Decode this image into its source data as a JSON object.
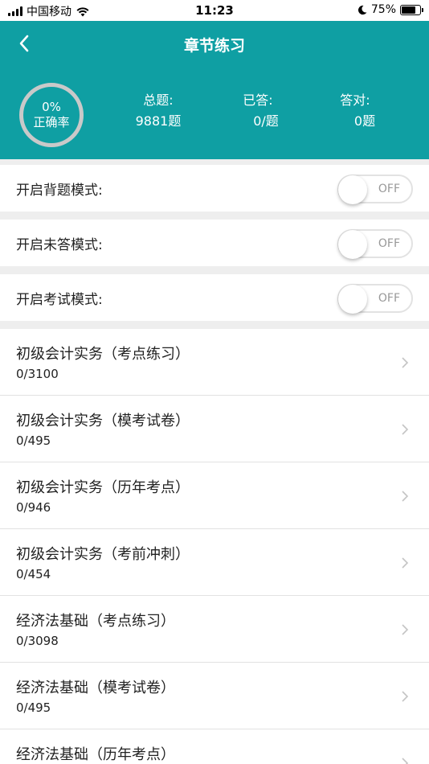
{
  "status_bar": {
    "carrier": "中国移动",
    "time": "11:23",
    "battery_percent": "75%",
    "battery_level": 0.75
  },
  "header": {
    "title": "章节练习",
    "back_icon": "chevron-left-icon",
    "accuracy": {
      "value": "0%",
      "label": "正确率"
    },
    "stats": {
      "total": {
        "label": "总题:",
        "value": "9881题"
      },
      "answered": {
        "label": "已答:",
        "value": "0/题"
      },
      "correct": {
        "label": "答对:",
        "value": "0题"
      }
    },
    "background_color": "#0f9fa3"
  },
  "toggles": [
    {
      "label": "开启背题模式:",
      "state": "OFF"
    },
    {
      "label": "开启未答模式:",
      "state": "OFF"
    },
    {
      "label": "开启考试模式:",
      "state": "OFF"
    }
  ],
  "chapters": [
    {
      "title": "初级会计实务（考点练习）",
      "count": "0/3100"
    },
    {
      "title": "初级会计实务（模考试卷）",
      "count": "0/495"
    },
    {
      "title": "初级会计实务（历年考点）",
      "count": "0/946"
    },
    {
      "title": "初级会计实务（考前冲刺）",
      "count": "0/454"
    },
    {
      "title": "经济法基础（考点练习）",
      "count": "0/3098"
    },
    {
      "title": "经济法基础（模考试卷）",
      "count": "0/495"
    },
    {
      "title": "经济法基础（历年考点）",
      "count": ""
    }
  ]
}
